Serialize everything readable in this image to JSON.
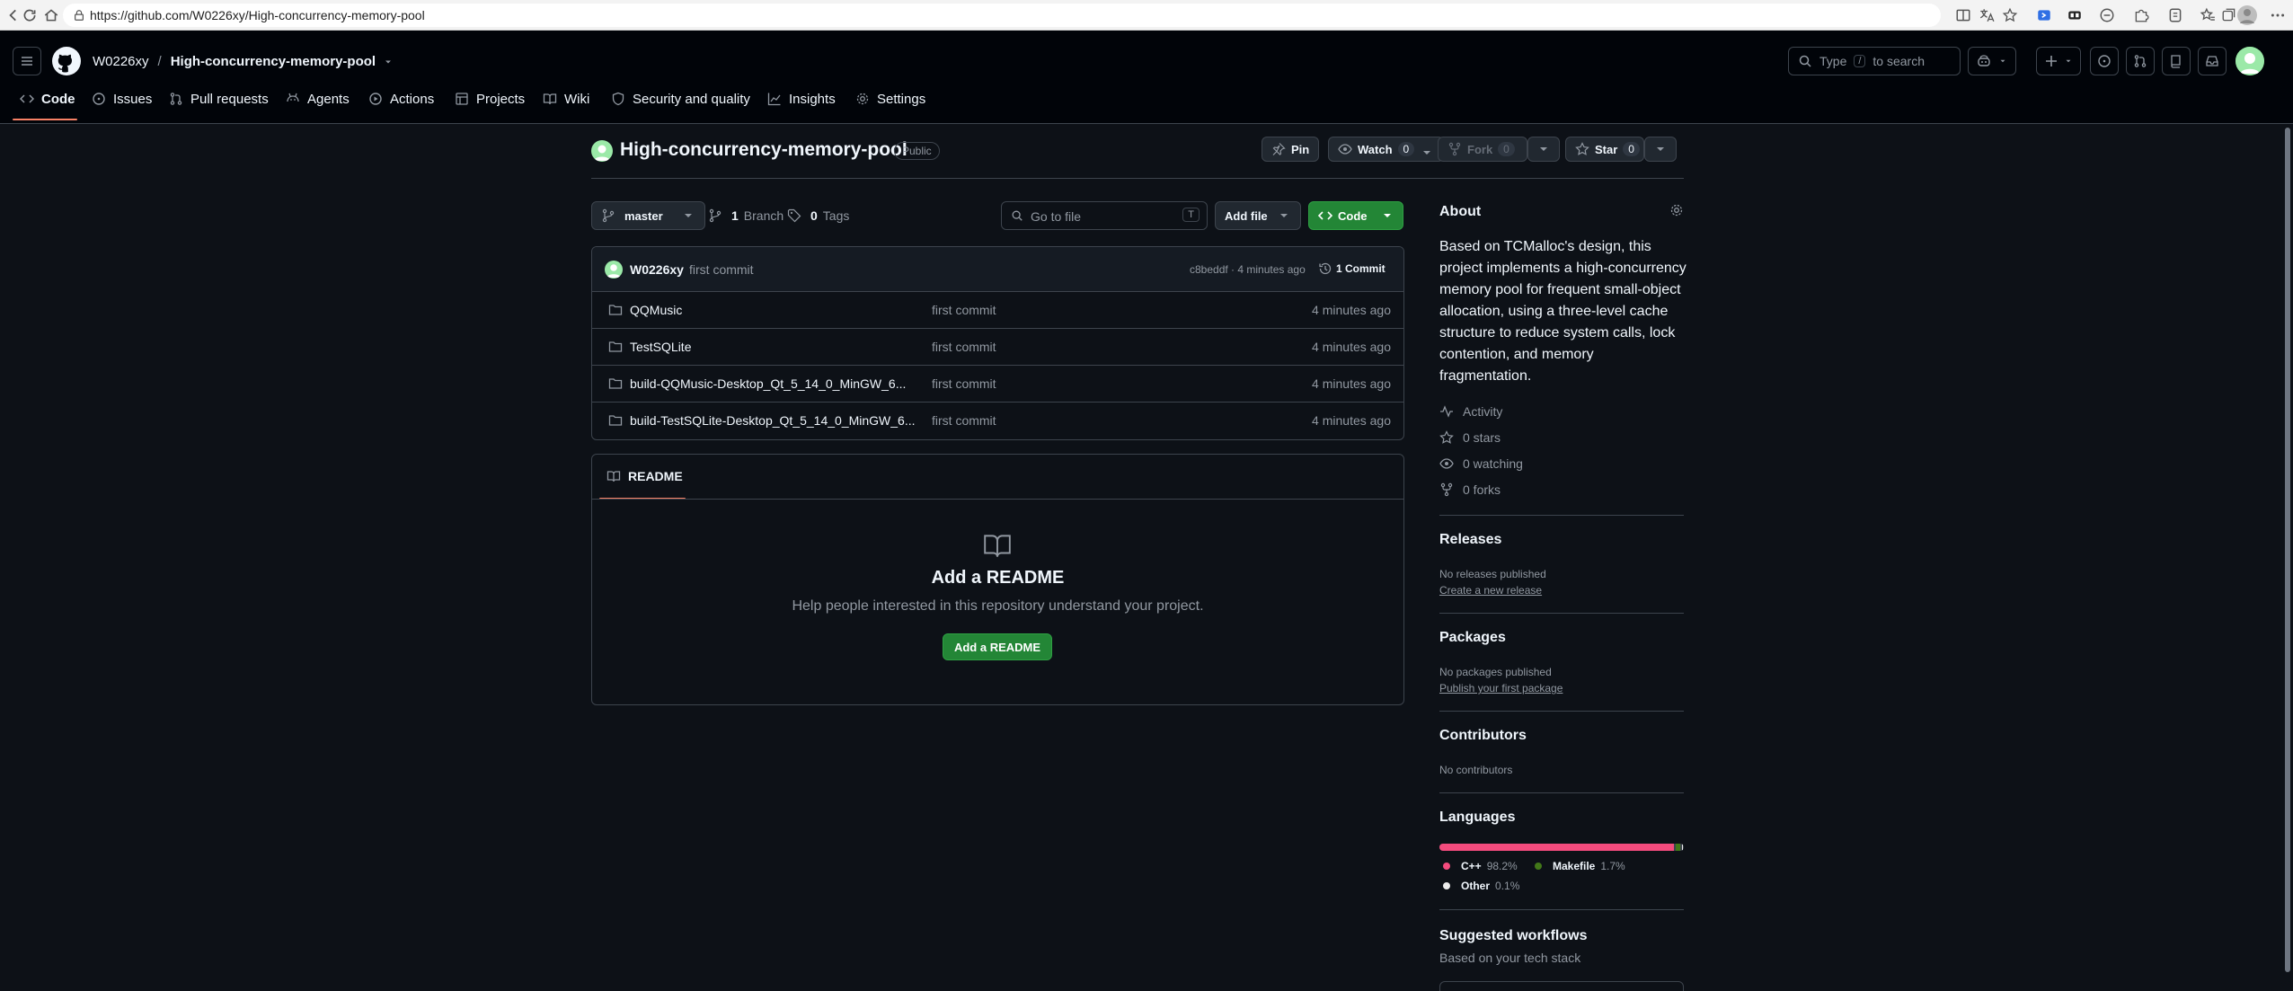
{
  "browser": {
    "url": "https://github.com/W0226xy/High-concurrency-memory-pool"
  },
  "header": {
    "owner": "W0226xy",
    "separator": "/",
    "repo": "High-concurrency-memory-pool",
    "search_placeholder_pre": "Type",
    "search_key": "/",
    "search_placeholder_post": "to search"
  },
  "tabs": [
    {
      "label": "Code",
      "icon": "code-icon",
      "selected": true
    },
    {
      "label": "Issues",
      "icon": "issue-icon"
    },
    {
      "label": "Pull requests",
      "icon": "pull-request-icon"
    },
    {
      "label": "Agents",
      "icon": "agents-icon"
    },
    {
      "label": "Actions",
      "icon": "play-icon"
    },
    {
      "label": "Projects",
      "icon": "table-icon"
    },
    {
      "label": "Wiki",
      "icon": "book-icon"
    },
    {
      "label": "Security and quality",
      "icon": "shield-icon"
    },
    {
      "label": "Insights",
      "icon": "graph-icon"
    },
    {
      "label": "Settings",
      "icon": "gear-icon"
    }
  ],
  "repo": {
    "title": "High-concurrency-memory-pool",
    "visibility": "Public",
    "pin_label": "Pin",
    "watch_label": "Watch",
    "watch_count": "0",
    "fork_label": "Fork",
    "fork_count": "0",
    "star_label": "Star",
    "star_count": "0"
  },
  "toolbar": {
    "branch": "master",
    "branch_count": "1",
    "branch_label": "Branch",
    "tag_count": "0",
    "tag_label": "Tags",
    "goto_placeholder": "Go to file",
    "goto_key": "T",
    "add_file": "Add file",
    "code": "Code"
  },
  "commit": {
    "author": "W0226xy",
    "message": "first commit",
    "hash_time": "c8beddf · 4 minutes ago",
    "count": "1 Commit"
  },
  "files": [
    {
      "name": "QQMusic",
      "message": "first commit",
      "time": "4 minutes ago"
    },
    {
      "name": "TestSQLite",
      "message": "first commit",
      "time": "4 minutes ago"
    },
    {
      "name": "build-QQMusic-Desktop_Qt_5_14_0_MinGW_6...",
      "message": "first commit",
      "time": "4 minutes ago"
    },
    {
      "name": "build-TestSQLite-Desktop_Qt_5_14_0_MinGW_6...",
      "message": "first commit",
      "time": "4 minutes ago"
    }
  ],
  "readme": {
    "tab": "README",
    "heading": "Add a README",
    "text": "Help people interested in this repository understand your project.",
    "button": "Add a README"
  },
  "about": {
    "heading": "About",
    "description": "Based on TCMalloc's design, this project implements a high-concurrency memory pool for frequent small-object allocation, using a three-level cache structure to reduce system calls, lock contention, and memory fragmentation.",
    "activity": "Activity",
    "stars": "0 stars",
    "watching": "0 watching",
    "forks": "0 forks"
  },
  "releases": {
    "heading": "Releases",
    "none": "No releases published",
    "link": "Create a new release"
  },
  "packages": {
    "heading": "Packages",
    "none": "No packages published",
    "link": "Publish your first package"
  },
  "contributors": {
    "heading": "Contributors",
    "none": "No contributors"
  },
  "languages": {
    "heading": "Languages",
    "items": [
      {
        "name": "C++",
        "percent": "98.2%",
        "value": 98.2,
        "color": "#f34b7d"
      },
      {
        "name": "Makefile",
        "percent": "1.7%",
        "value": 1.7,
        "color": "#427819"
      },
      {
        "name": "Other",
        "percent": "0.1%",
        "value": 0.1,
        "color": "#ededed"
      }
    ]
  },
  "workflows": {
    "heading": "Suggested workflows",
    "sub": "Based on your tech stack"
  }
}
